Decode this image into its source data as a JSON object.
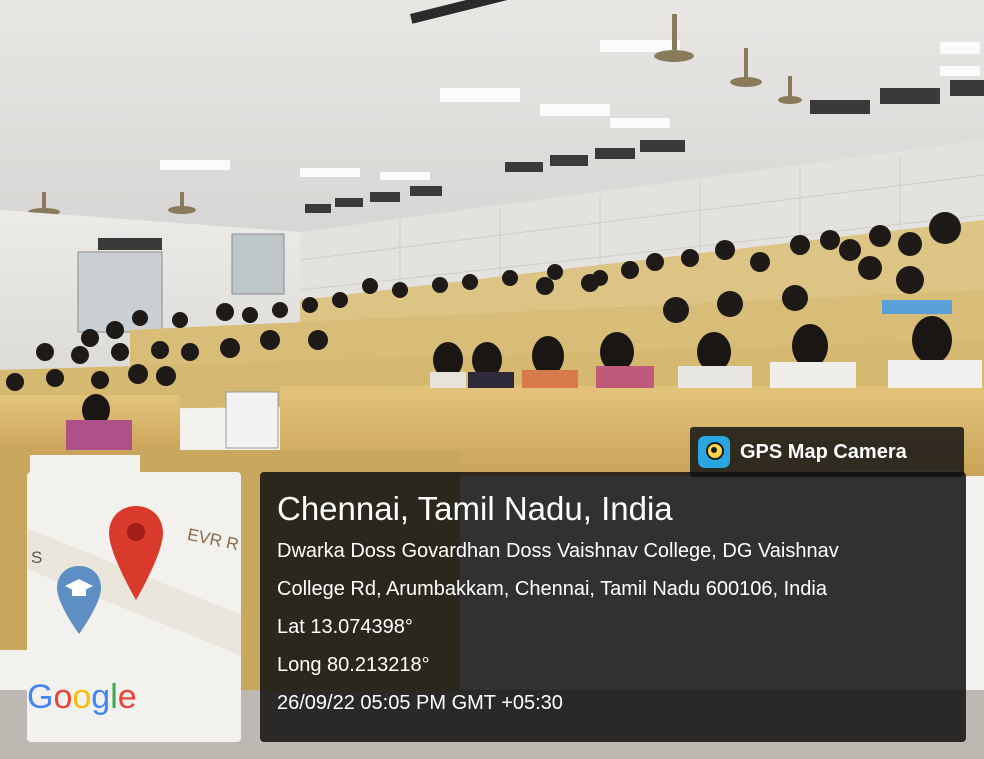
{
  "badge": {
    "app_name": "GPS Map Camera",
    "icon": "gps-map-camera-app-icon"
  },
  "location": {
    "city_line": "Chennai, Tamil Nadu, India",
    "address_line_1": "Dwarka Doss Govardhan Doss Vaishnav College, DG Vaishnav",
    "address_line_2": "College Rd, Arumbakkam, Chennai, Tamil Nadu 600106, India",
    "latitude": "Lat 13.074398°",
    "longitude": "Long 80.213218°",
    "timestamp": "26/09/22 05:05 PM GMT +05:30"
  },
  "map": {
    "road_label": "EVR R",
    "edge_letter": "S",
    "logo": {
      "g": "G",
      "o1": "o",
      "o2": "o",
      "g2": "g",
      "l": "l",
      "e": "e"
    },
    "pin_icon": "map-pin-icon",
    "school_icon": "graduation-cap-pin-icon"
  },
  "colors": {
    "overlay_bg": "#121212",
    "pin_red": "#d93a2b",
    "pin_blue": "#5d8fc4",
    "seat_wood": "#d9b86a"
  }
}
